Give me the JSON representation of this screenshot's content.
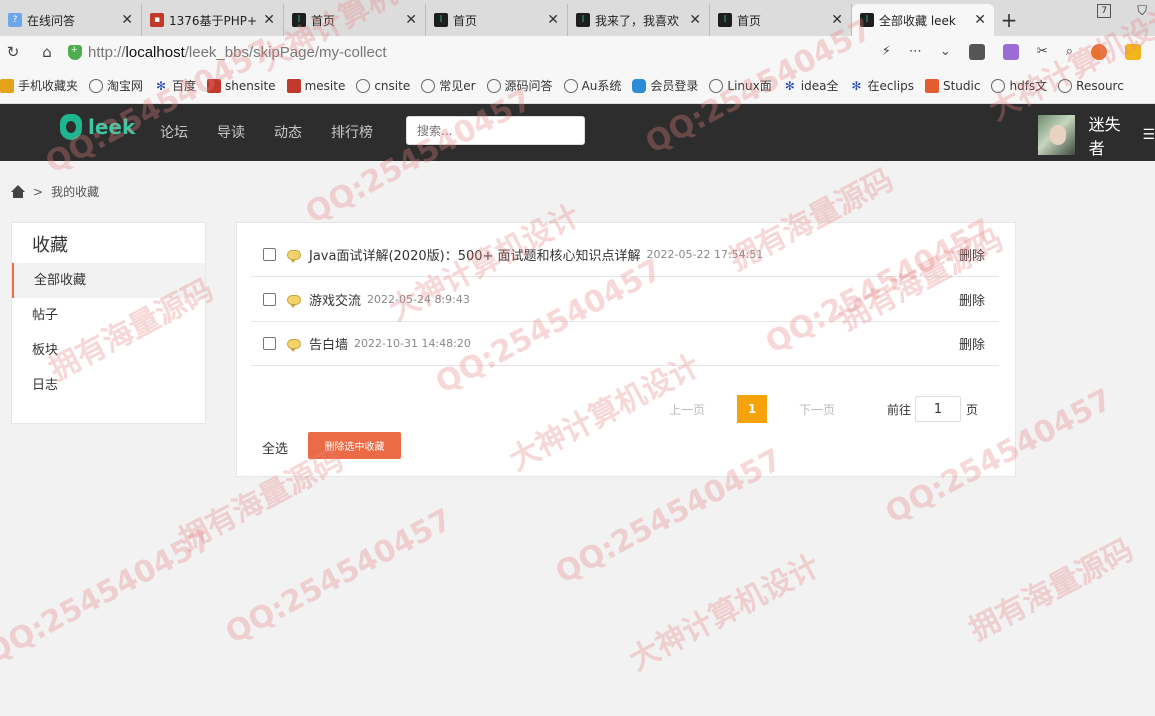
{
  "browser": {
    "tabs": [
      {
        "title": "在线问答",
        "icon": "qa-icon"
      },
      {
        "title": "1376基于PHP+",
        "icon": "red-square-icon"
      },
      {
        "title": "首页",
        "icon": "leek-icon"
      },
      {
        "title": "首页",
        "icon": "leek-icon"
      },
      {
        "title": "我来了，我喜欢",
        "icon": "leek-icon"
      },
      {
        "title": "首页",
        "icon": "leek-icon"
      },
      {
        "title": "全部收藏 leek",
        "icon": "leek-icon",
        "active": true
      }
    ],
    "new_tab": "+",
    "counter": "7",
    "url_scheme": "http://",
    "url_host": "localhost",
    "url_path": "/leek_bbs/skipPage/my-collect",
    "bookmarks": [
      {
        "label": "手机收藏夹",
        "icon": "folder-icon"
      },
      {
        "label": "淘宝网",
        "icon": "globe-icon"
      },
      {
        "label": "百度",
        "icon": "paw-icon"
      },
      {
        "label": "shensite",
        "icon": "red-square-icon"
      },
      {
        "label": "mesite",
        "icon": "red-square-icon"
      },
      {
        "label": "cnsite",
        "icon": "globe-icon"
      },
      {
        "label": "常见er",
        "icon": "globe-icon"
      },
      {
        "label": "源码问答",
        "icon": "qa-icon"
      },
      {
        "label": "Au系统",
        "icon": "globe-icon"
      },
      {
        "label": "会员登录",
        "icon": "cloud-icon"
      },
      {
        "label": "Linux面",
        "icon": "globe-icon"
      },
      {
        "label": "idea全",
        "icon": "paw-icon"
      },
      {
        "label": "在eclips",
        "icon": "paw-icon"
      },
      {
        "label": "Studic",
        "icon": "c-icon"
      },
      {
        "label": "hdfs文",
        "icon": "globe-icon"
      },
      {
        "label": "Resourc",
        "icon": "globe-icon"
      }
    ]
  },
  "site": {
    "logo_text": "leek",
    "nav": [
      "论坛",
      "导读",
      "动态",
      "排行榜"
    ],
    "search_placeholder": "搜索...",
    "username": "迷失者"
  },
  "breadcrumb": {
    "sep": ">",
    "current": "我的收藏"
  },
  "sidebar": {
    "title": "收藏",
    "items": [
      {
        "label": "全部收藏",
        "active": true
      },
      {
        "label": "帖子"
      },
      {
        "label": "板块"
      },
      {
        "label": "日志"
      }
    ]
  },
  "collections": [
    {
      "title": "Java面试详解(2020版)：500+ 面试题和核心知识点详解",
      "time": "2022-05-22 17:54:51",
      "delete": "删除"
    },
    {
      "title": "游戏交流",
      "time": "2022-05-24 8:9:43",
      "delete": "删除"
    },
    {
      "title": "告白墙",
      "time": "2022-10-31 14:48:20",
      "delete": "删除"
    }
  ],
  "pagination": {
    "prev": "上一页",
    "current": "1",
    "next": "下一页",
    "goto": "前往",
    "page_value": "1",
    "page_unit": "页"
  },
  "actions": {
    "select_all": "全选",
    "delete_selected": "删除选中收藏"
  },
  "watermark": [
    "QQ:254540457",
    "大神计算机设计",
    "拥有海量源码"
  ],
  "colors": {
    "header_bg": "#2d2d2d",
    "accent_orange": "#ea6b46",
    "pager_active": "#f5a20b",
    "logo_green": "#1fb58f"
  }
}
